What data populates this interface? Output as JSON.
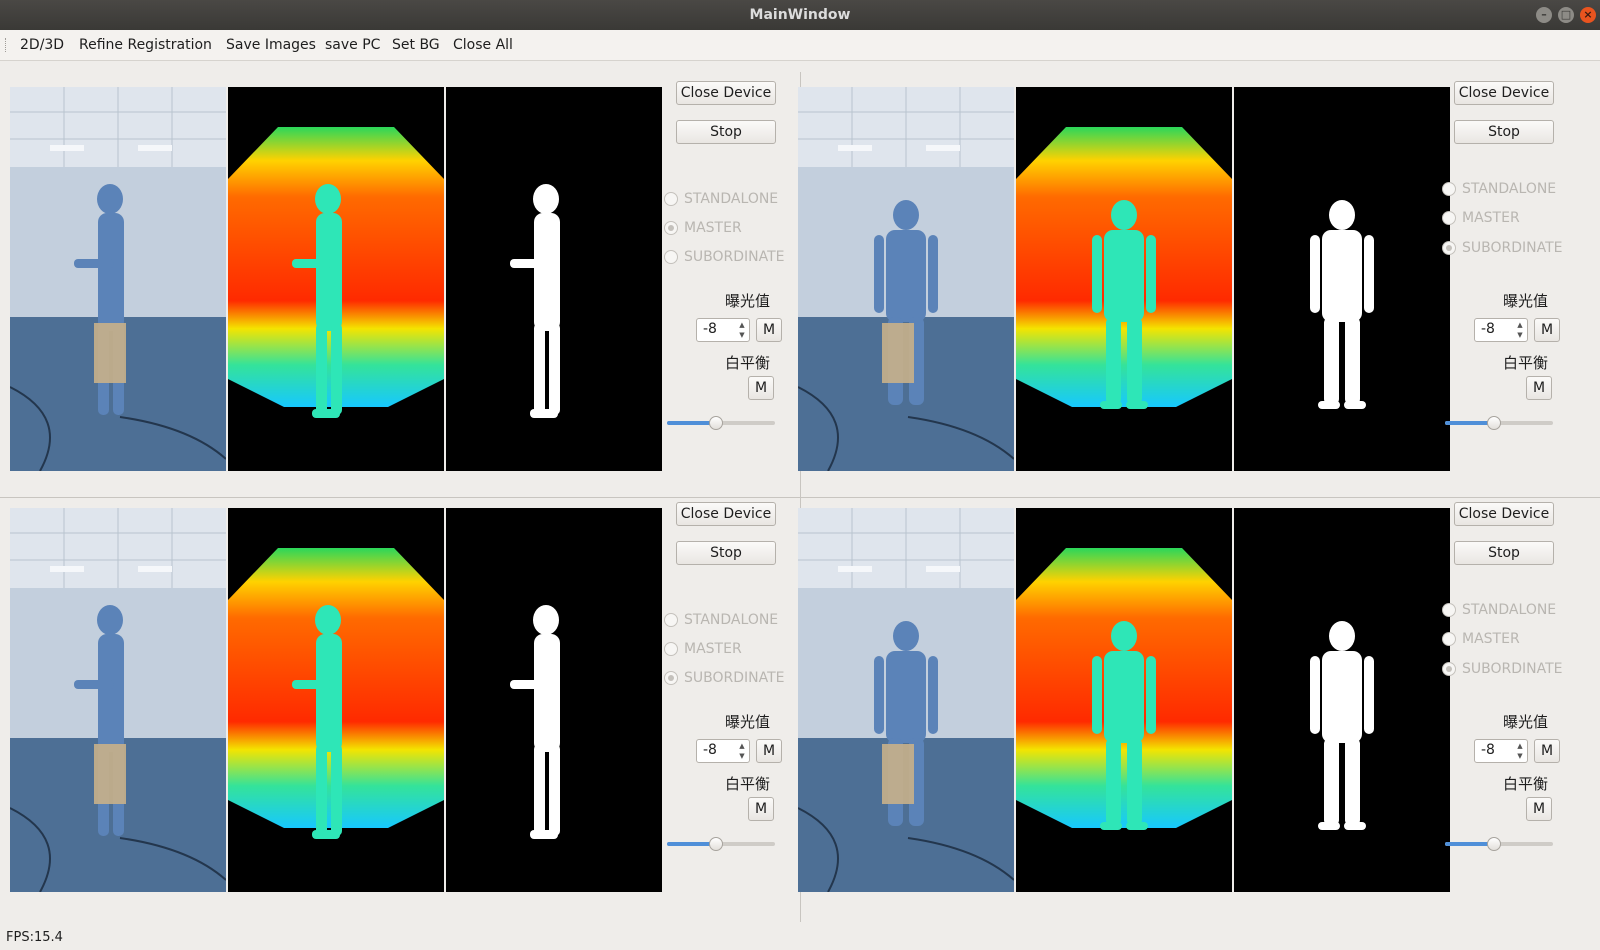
{
  "window": {
    "title": "MainWindow"
  },
  "menu": [
    "2D/3D",
    "Refine Registration",
    "Save Images",
    "save PC",
    "Set BG",
    "Close All"
  ],
  "panels": [
    {
      "close_device": "Close Device",
      "stop": "Stop",
      "modes": [
        "STANDALONE",
        "MASTER",
        "SUBORDINATE"
      ],
      "selected_mode": "MASTER",
      "exposure_label": "曝光值",
      "exposure_value": "-8",
      "exposure_m": "M",
      "wb_label": "白平衡",
      "wb_m": "M",
      "slider_fraction": 0.44,
      "view": "side"
    },
    {
      "close_device": "Close Device",
      "stop": "Stop",
      "modes": [
        "STANDALONE",
        "MASTER",
        "SUBORDINATE"
      ],
      "selected_mode": "SUBORDINATE",
      "exposure_label": "曝光值",
      "exposure_value": "-8",
      "exposure_m": "M",
      "wb_label": "白平衡",
      "wb_m": "M",
      "slider_fraction": 0.44,
      "view": "back"
    },
    {
      "close_device": "Close Device",
      "stop": "Stop",
      "modes": [
        "STANDALONE",
        "MASTER",
        "SUBORDINATE"
      ],
      "selected_mode": "SUBORDINATE",
      "exposure_label": "曝光值",
      "exposure_value": "-8",
      "exposure_m": "M",
      "wb_label": "白平衡",
      "wb_m": "M",
      "slider_fraction": 0.44,
      "view": "side"
    },
    {
      "close_device": "Close Device",
      "stop": "Stop",
      "modes": [
        "STANDALONE",
        "MASTER",
        "SUBORDINATE"
      ],
      "selected_mode": "SUBORDINATE",
      "exposure_label": "曝光值",
      "exposure_value": "-8",
      "exposure_m": "M",
      "wb_label": "白平衡",
      "wb_m": "M",
      "slider_fraction": 0.44,
      "view": "front"
    }
  ],
  "status": {
    "fps": "FPS:15.4"
  },
  "colors": {
    "accent": "#4f8fd8",
    "titlebar": "#3a3936",
    "close_button": "#e9541f"
  }
}
